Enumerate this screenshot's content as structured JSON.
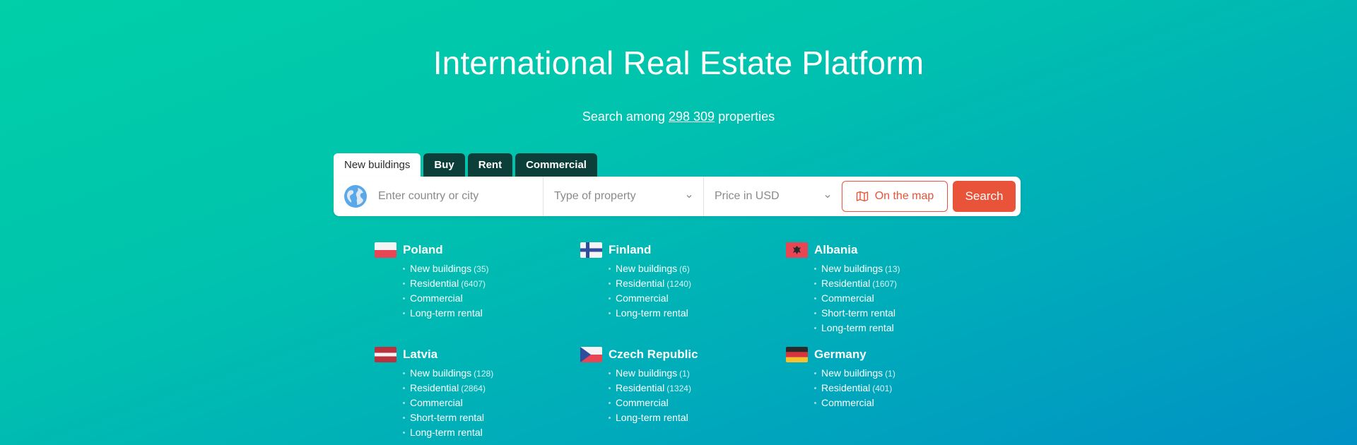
{
  "hero": {
    "title": "International Real Estate Platform",
    "subtitle_prefix": "Search among",
    "count": "298 309",
    "subtitle_suffix": "properties"
  },
  "tabs": [
    {
      "label": "New buildings",
      "active": true
    },
    {
      "label": "Buy",
      "active": false
    },
    {
      "label": "Rent",
      "active": false
    },
    {
      "label": "Commercial",
      "active": false
    }
  ],
  "search": {
    "city_placeholder": "Enter country or city",
    "type_placeholder": "Type of property",
    "price_placeholder": "Price in USD",
    "map_label": "On the map",
    "search_label": "Search"
  },
  "icons": {
    "globe": "globe-icon",
    "map": "map-icon",
    "chevron": "chevron-down-icon"
  },
  "colors": {
    "accent": "#e8533a",
    "tab_dark": "#0d3f3a"
  },
  "countries": [
    {
      "name": "Poland",
      "flag": "poland",
      "links": [
        {
          "label": "New buildings",
          "count": "(35)"
        },
        {
          "label": "Residential",
          "count": "(6407)"
        },
        {
          "label": "Commercial",
          "count": ""
        },
        {
          "label": "Long-term rental",
          "count": ""
        }
      ]
    },
    {
      "name": "Finland",
      "flag": "finland",
      "links": [
        {
          "label": "New buildings",
          "count": "(6)"
        },
        {
          "label": "Residential",
          "count": "(1240)"
        },
        {
          "label": "Commercial",
          "count": ""
        },
        {
          "label": "Long-term rental",
          "count": ""
        }
      ]
    },
    {
      "name": "Albania",
      "flag": "albania",
      "links": [
        {
          "label": "New buildings",
          "count": "(13)"
        },
        {
          "label": "Residential",
          "count": "(1607)"
        },
        {
          "label": "Commercial",
          "count": ""
        },
        {
          "label": "Short-term rental",
          "count": ""
        },
        {
          "label": "Long-term rental",
          "count": ""
        }
      ]
    },
    {
      "name": "Latvia",
      "flag": "latvia",
      "links": [
        {
          "label": "New buildings",
          "count": "(128)"
        },
        {
          "label": "Residential",
          "count": "(2864)"
        },
        {
          "label": "Commercial",
          "count": ""
        },
        {
          "label": "Short-term rental",
          "count": ""
        },
        {
          "label": "Long-term rental",
          "count": ""
        }
      ]
    },
    {
      "name": "Czech Republic",
      "flag": "czech",
      "links": [
        {
          "label": "New buildings",
          "count": "(1)"
        },
        {
          "label": "Residential",
          "count": "(1324)"
        },
        {
          "label": "Commercial",
          "count": ""
        },
        {
          "label": "Long-term rental",
          "count": ""
        }
      ]
    },
    {
      "name": "Germany",
      "flag": "germany",
      "links": [
        {
          "label": "New buildings",
          "count": "(1)"
        },
        {
          "label": "Residential",
          "count": "(401)"
        },
        {
          "label": "Commercial",
          "count": ""
        }
      ]
    }
  ]
}
